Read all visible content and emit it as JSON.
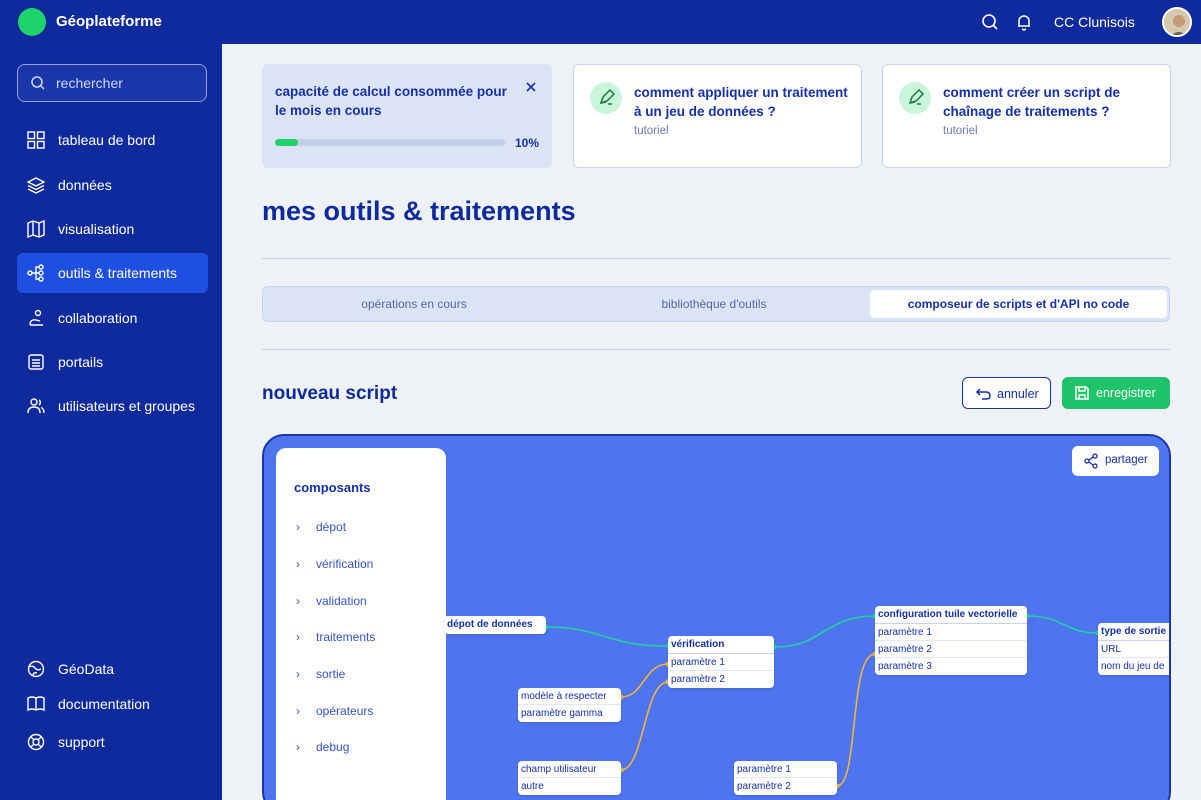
{
  "topbar": {
    "brand": "Géoplateforme",
    "org": "CC Clunisois"
  },
  "sidebar": {
    "search_placeholder": "rechercher",
    "items": [
      {
        "label": "tableau de bord",
        "icon": "dashboard-icon"
      },
      {
        "label": "données",
        "icon": "layers-icon"
      },
      {
        "label": "visualisation",
        "icon": "map-icon"
      },
      {
        "label": "outils & traitements",
        "icon": "nodes-icon",
        "active": true
      },
      {
        "label": "collaboration",
        "icon": "collaboration-icon"
      },
      {
        "label": "portails",
        "icon": "portal-icon"
      },
      {
        "label": "utilisateurs et groupes",
        "icon": "users-icon"
      }
    ],
    "bottom": [
      {
        "label": "GéoData",
        "icon": "globe-icon"
      },
      {
        "label": "documentation",
        "icon": "book-icon"
      },
      {
        "label": "support",
        "icon": "lifebuoy-icon"
      }
    ]
  },
  "usage_card": {
    "title": "capacité de calcul consommée pour le mois en cours",
    "percent_label": "10%",
    "percent": 10
  },
  "tutorials": [
    {
      "title": "comment appliquer un traitement à un jeu de données ?",
      "type": "tutoriel"
    },
    {
      "title": "comment créer un script de chaînage de traitements ?",
      "type": "tutoriel"
    }
  ],
  "page_title": "mes outils & traitements",
  "tabs": [
    {
      "label": "opérations en cours"
    },
    {
      "label": "bibliothèque d'outils"
    },
    {
      "label": "composeur de scripts et d'API no code",
      "active": true
    }
  ],
  "script": {
    "title": "nouveau script",
    "cancel_label": "annuler",
    "save_label": "enregistrer",
    "share_label": "partager"
  },
  "components": {
    "title": "composants",
    "items": [
      "dépot",
      "vérification",
      "validation",
      "traitements",
      "sortie",
      "opérateurs",
      "debug"
    ]
  },
  "nodes": {
    "depot": {
      "title": "dépot de données"
    },
    "verification": {
      "title": "vérification",
      "params": [
        "paramètre 1",
        "paramètre 2"
      ]
    },
    "config": {
      "title": "configuration tuile vectorielle",
      "params": [
        "paramètre 1",
        "paramètre 2",
        "paramètre 3"
      ]
    },
    "output": {
      "title": "type de sortie",
      "params": [
        "URL",
        "nom du jeu de"
      ]
    },
    "model": {
      "rows": [
        "modèle à respecter",
        "paramètre gamma"
      ]
    },
    "user": {
      "rows": [
        "champ utilisateur",
        "autre"
      ]
    },
    "params2": {
      "rows": [
        "paramètre 1",
        "paramètre 2"
      ]
    }
  },
  "colors": {
    "primary": "#0f2a9c",
    "accent": "#1fd36b",
    "canvas": "#4f74f0",
    "wire_data": "#1fd3a0",
    "wire_param": "#f0b43a"
  }
}
